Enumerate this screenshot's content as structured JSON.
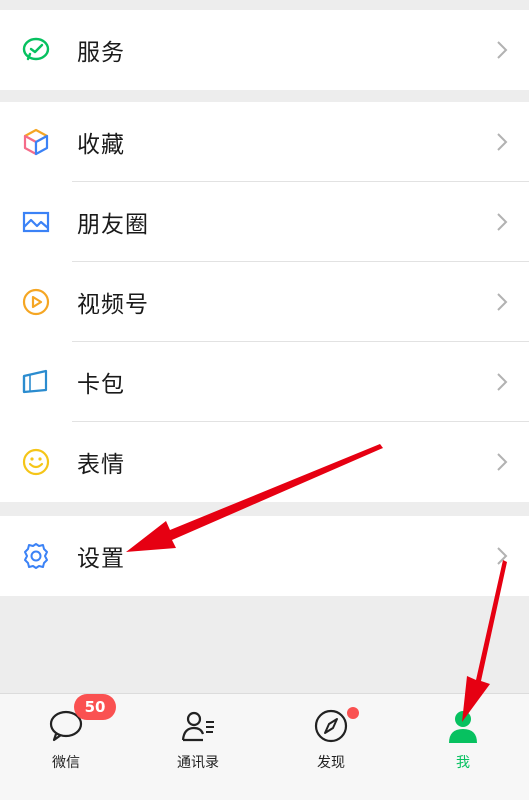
{
  "groups": {
    "service": {
      "label": "服务",
      "icon": "wechat-pay-icon"
    },
    "main": [
      {
        "label": "收藏",
        "icon": "favorites-cube-icon"
      },
      {
        "label": "朋友圈",
        "icon": "moments-photo-icon"
      },
      {
        "label": "视频号",
        "icon": "channels-play-icon"
      },
      {
        "label": "卡包",
        "icon": "card-wallet-icon"
      },
      {
        "label": "表情",
        "icon": "sticker-smile-icon"
      }
    ],
    "settings": {
      "label": "设置",
      "icon": "gear-icon"
    }
  },
  "tabbar": {
    "tabs": [
      {
        "label": "微信",
        "icon": "chat-bubble-icon",
        "badge": "50"
      },
      {
        "label": "通讯录",
        "icon": "contacts-icon"
      },
      {
        "label": "发现",
        "icon": "compass-icon",
        "dot": true
      },
      {
        "label": "我",
        "icon": "person-icon",
        "active": true
      }
    ]
  },
  "colors": {
    "accent": "#07c160",
    "badge": "#fa5151",
    "annotation_arrow": "#e60012"
  }
}
